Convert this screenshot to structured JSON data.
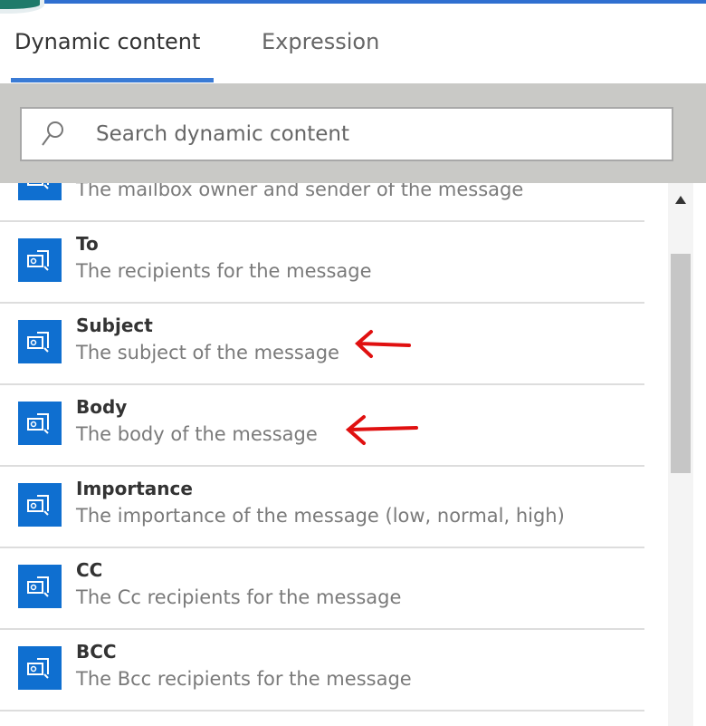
{
  "tabs": [
    {
      "label": "Dynamic content",
      "active": true
    },
    {
      "label": "Expression",
      "active": false
    }
  ],
  "search": {
    "placeholder": "Search dynamic content"
  },
  "items": [
    {
      "title": "",
      "desc": "The mailbox owner and sender of the message"
    },
    {
      "title": "To",
      "desc": "The recipients for the message"
    },
    {
      "title": "Subject",
      "desc": "The subject of the message"
    },
    {
      "title": "Body",
      "desc": "The body of the message"
    },
    {
      "title": "Importance",
      "desc": "The importance of the message (low, normal, high)"
    },
    {
      "title": "CC",
      "desc": "The Cc recipients for the message"
    },
    {
      "title": "BCC",
      "desc": "The Bcc recipients for the message"
    }
  ],
  "colors": {
    "accent": "#0f6fd0",
    "annotation": "#e01010"
  }
}
